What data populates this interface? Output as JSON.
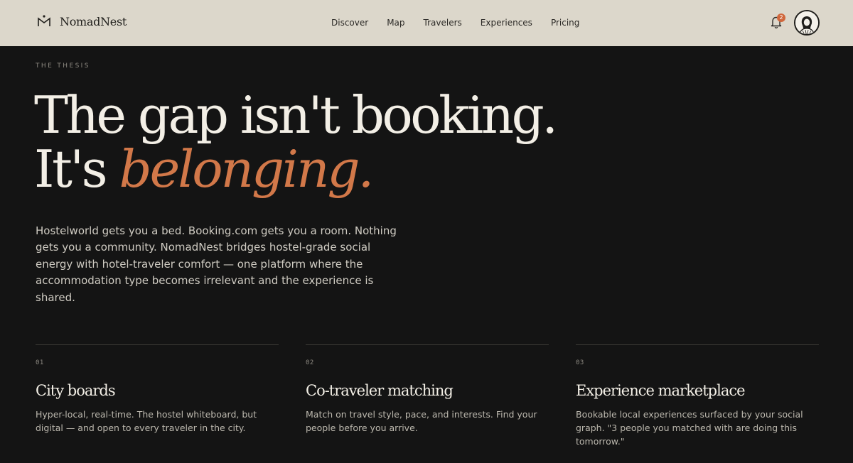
{
  "header": {
    "brand_name": "NomadNest",
    "nav": [
      "Discover",
      "Map",
      "Travelers",
      "Experiences",
      "Pricing"
    ],
    "notification_count": "2",
    "brand_icon": "mountain-mark-icon",
    "notification_icon": "bell-icon",
    "avatar_icon": "user-avatar-illustration"
  },
  "hero": {
    "eyebrow": "THE THESIS",
    "headline_line1": "The gap isn't booking.",
    "headline_line2_prefix": "It's ",
    "headline_accent": "belonging.",
    "lede": "Hostelworld gets you a bed. Booking.com gets you a room. Nothing gets you a community. NomadNest bridges hostel-grade social energy with hotel-traveler comfort — one platform where the accommodation type becomes irrelevant and the experience is shared."
  },
  "features": [
    {
      "number": "01",
      "title": "City boards",
      "description": "Hyper-local, real-time. The hostel whiteboard, but digital — and open to every traveler in the city."
    },
    {
      "number": "02",
      "title": "Co-traveler matching",
      "description": "Match on travel style, pace, and interests. Find your people before you arrive."
    },
    {
      "number": "03",
      "title": "Experience marketplace",
      "description": "Bookable local experiences surfaced by your social graph. \"3 people you matched with are doing this tomorrow.\""
    }
  ],
  "colors": {
    "background": "#141414",
    "header_background": "#dcd7cb",
    "accent": "#d27849",
    "badge": "#d0673c"
  }
}
